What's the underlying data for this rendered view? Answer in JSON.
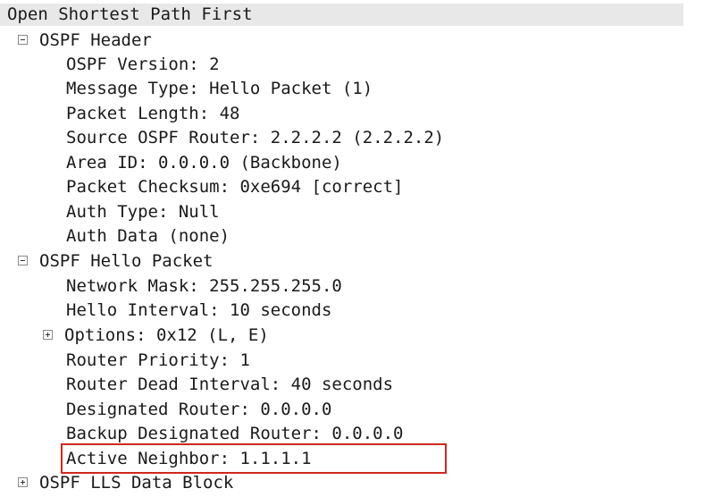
{
  "tree": {
    "title": "Open Shortest Path First",
    "header": {
      "label": "OSPF Header",
      "expanded": true,
      "fields": [
        "OSPF Version: 2",
        "Message Type: Hello Packet (1)",
        "Packet Length: 48",
        "Source OSPF Router: 2.2.2.2 (2.2.2.2)",
        "Area ID: 0.0.0.0 (Backbone)",
        "Packet Checksum: 0xe694 [correct]",
        "Auth Type: Null",
        "Auth Data (none)"
      ]
    },
    "hello": {
      "label": "OSPF Hello Packet",
      "expanded": true,
      "network_mask": "Network Mask: 255.255.255.0",
      "hello_interval": "Hello Interval: 10 seconds",
      "options": {
        "label": "Options: 0x12 (L, E)",
        "expanded": false
      },
      "router_priority": "Router Priority: 1",
      "dead_interval": "Router Dead Interval: 40 seconds",
      "designated_router": "Designated Router: 0.0.0.0",
      "backup_designated_router": "Backup Designated Router: 0.0.0.0",
      "active_neighbor": "Active Neighbor: 1.1.1.1"
    },
    "lls": {
      "label": "OSPF LLS Data Block",
      "expanded": false
    }
  },
  "colors": {
    "highlight_border": "#d0281e",
    "top_row_background": "#e8e8e8"
  }
}
